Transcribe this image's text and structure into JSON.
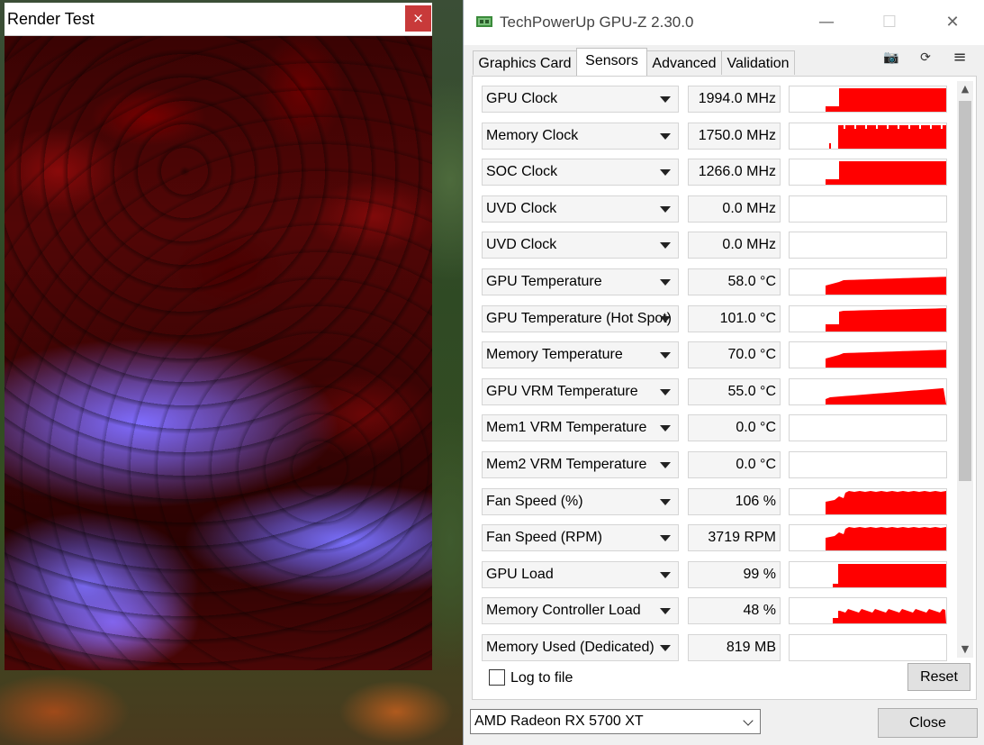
{
  "render_window": {
    "title": "Render Test",
    "close_label": "×"
  },
  "gpuz": {
    "title": "TechPowerUp GPU-Z 2.30.0",
    "window_controls": {
      "minimize": "—",
      "maximize": "☐",
      "close": "✕"
    },
    "tabs": [
      {
        "label": "Graphics Card",
        "active": false
      },
      {
        "label": "Sensors",
        "active": true
      },
      {
        "label": "Advanced",
        "active": false
      },
      {
        "label": "Validation",
        "active": false
      }
    ],
    "toolbar": {
      "camera_icon": "📷",
      "refresh_icon": "⟳",
      "menu_icon": "≡"
    },
    "graph_color": "#ff0000",
    "sensors": [
      {
        "name": "GPU Clock",
        "value": "1994.0 MHz",
        "graph": "clock"
      },
      {
        "name": "Memory Clock",
        "value": "1750.0 MHz",
        "graph": "memclock"
      },
      {
        "name": "SOC Clock",
        "value": "1266.0 MHz",
        "graph": "clock"
      },
      {
        "name": "UVD Clock",
        "value": "0.0 MHz",
        "graph": "none"
      },
      {
        "name": "UVD Clock",
        "value": "0.0 MHz",
        "graph": "none"
      },
      {
        "name": "GPU Temperature",
        "value": "58.0 °C",
        "graph": "temp_low"
      },
      {
        "name": "GPU Temperature (Hot Spot)",
        "value": "101.0 °C",
        "graph": "temp_high"
      },
      {
        "name": "Memory Temperature",
        "value": "70.0 °C",
        "graph": "temp_low"
      },
      {
        "name": "GPU VRM Temperature",
        "value": "55.0 °C",
        "graph": "temp_ramp"
      },
      {
        "name": "Mem1 VRM Temperature",
        "value": "0.0 °C",
        "graph": "none"
      },
      {
        "name": "Mem2 VRM Temperature",
        "value": "0.0 °C",
        "graph": "none"
      },
      {
        "name": "Fan Speed (%)",
        "value": "106 %",
        "graph": "fan"
      },
      {
        "name": "Fan Speed (RPM)",
        "value": "3719 RPM",
        "graph": "fan"
      },
      {
        "name": "GPU Load",
        "value": "99 %",
        "graph": "load"
      },
      {
        "name": "Memory Controller Load",
        "value": "48 %",
        "graph": "memload"
      },
      {
        "name": "Memory Used (Dedicated)",
        "value": "819 MB",
        "graph": "none"
      }
    ],
    "log_to_file": {
      "label": "Log to file",
      "checked": false
    },
    "reset_label": "Reset",
    "device": {
      "selected": "AMD Radeon RX 5700 XT"
    },
    "close_label": "Close"
  }
}
